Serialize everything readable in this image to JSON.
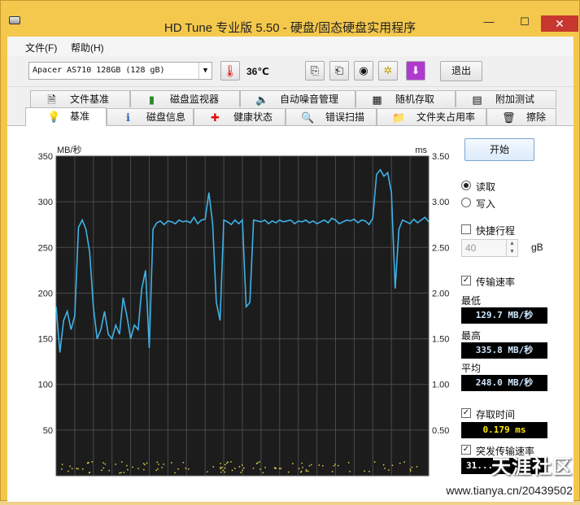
{
  "window": {
    "title": "HD Tune 专业版 5.50 - 硬盘/固态硬盘实用程序",
    "minimize": "—",
    "maximize": "☐",
    "close": "✕"
  },
  "menu": {
    "file": "文件(F)",
    "help": "帮助(H)"
  },
  "toolbar": {
    "drive": "Apacer AS710 128GB (128 gB)",
    "temperature": "36℃",
    "exit_label": "退出"
  },
  "tabs_row1": [
    "文件基准",
    "磁盘监视器",
    "自动噪音管理",
    "随机存取",
    "附加测试"
  ],
  "tabs_row2": [
    "基准",
    "磁盘信息",
    "健康状态",
    "错误扫描",
    "文件夹占用率",
    "擦除"
  ],
  "active_tab": "基准",
  "side": {
    "start_label": "开始",
    "read_label": "读取",
    "write_label": "写入",
    "short_stroke_label": "快捷行程",
    "short_stroke_value": "40",
    "short_stroke_unit": "gB",
    "transfer_rate_label": "传输速率",
    "min_label": "最低",
    "min_value": "129.7 MB/秒",
    "max_label": "最高",
    "max_value": "335.8 MB/秒",
    "avg_label": "平均",
    "avg_value": "248.0 MB/秒",
    "access_time_label": "存取时间",
    "access_time_value": "0.179 ms",
    "burst_label": "突发传输速率",
    "burst_value": "31..."
  },
  "watermark": {
    "brand": "天涯社区",
    "url": "www.tianya.cn/20439502"
  },
  "colors": {
    "titlebar": "#f4c84c",
    "plot_bg": "#1c1c1c",
    "line": "#3fb2e6",
    "dots": "#e6d44a"
  },
  "chart_data": {
    "type": "line",
    "ylabel_left": "MB/秒",
    "ylabel_right": "ms",
    "ylim_left": [
      0,
      350
    ],
    "ylim_right": [
      0,
      3.5
    ],
    "yticks_left": [
      "350",
      "300",
      "250",
      "200",
      "150",
      "100",
      "50"
    ],
    "yticks_right": [
      "3.50",
      "3.00",
      "2.50",
      "2.00",
      "1.50",
      "1.00",
      "0.50"
    ],
    "grid": true,
    "series": [
      {
        "name": "transfer",
        "x": [
          0,
          1,
          2,
          3,
          4,
          5,
          6,
          7,
          8,
          9,
          10,
          11,
          12,
          13,
          14,
          15,
          16,
          17,
          18,
          19,
          20,
          21,
          22,
          23,
          24,
          25,
          26,
          27,
          28,
          29,
          30,
          31,
          32,
          33,
          34,
          35,
          36,
          37,
          38,
          39,
          40,
          41,
          42,
          43,
          44,
          45,
          46,
          47,
          48,
          49,
          50,
          51,
          52,
          53,
          54,
          55,
          56,
          57,
          58,
          59,
          60,
          61,
          62,
          63,
          64,
          65,
          66,
          67,
          68,
          69,
          70,
          71,
          72,
          73,
          74,
          75,
          76,
          77,
          78,
          79,
          80,
          81,
          82,
          83,
          84,
          85,
          86,
          87,
          88,
          89,
          90,
          91,
          92,
          93,
          94,
          95,
          96,
          97,
          98,
          99,
          100
        ],
        "values": [
          185,
          135,
          170,
          180,
          160,
          175,
          272,
          280,
          270,
          245,
          185,
          150,
          160,
          180,
          155,
          150,
          165,
          155,
          195,
          175,
          150,
          165,
          160,
          205,
          225,
          140,
          270,
          277,
          279,
          275,
          279,
          278,
          276,
          280,
          278,
          279,
          277,
          283,
          276,
          280,
          281,
          310,
          276,
          190,
          170,
          280,
          278,
          275,
          280,
          276,
          280,
          185,
          190,
          280,
          279,
          278,
          280,
          276,
          279,
          277,
          280,
          278,
          279,
          280,
          276,
          279,
          278,
          280,
          277,
          279,
          276,
          278,
          280,
          277,
          282,
          280,
          276,
          278,
          280,
          279,
          281,
          277,
          280,
          279,
          275,
          282,
          330,
          335,
          328,
          332,
          310,
          205,
          270,
          280,
          278,
          276,
          281,
          277,
          280,
          283,
          278
        ]
      }
    ]
  }
}
